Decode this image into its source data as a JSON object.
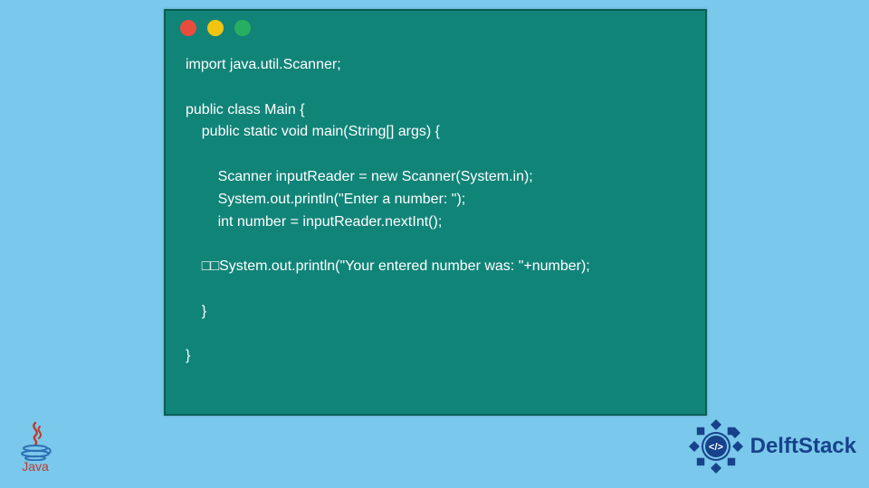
{
  "code": {
    "lines": [
      "import java.util.Scanner;",
      "",
      "public class Main {",
      "    public static void main(String[] args) {",
      "",
      "        Scanner inputReader = new Scanner(System.in);",
      "        System.out.println(\"Enter a number: \");",
      "        int number = inputReader.nextInt();",
      "",
      "    □□System.out.println(\"Your entered number was: \"+number);",
      "",
      "    }",
      "",
      "}"
    ]
  },
  "logos": {
    "java_label": "Java",
    "delft_label": "DelftStack"
  },
  "colors": {
    "bg": "#7ac8eb",
    "window": "#118478",
    "window_border": "#0a5d55",
    "dot_red": "#e74c3c",
    "dot_yellow": "#f1c40f",
    "dot_green": "#27ae60",
    "java_red": "#c0392b",
    "java_blue": "#2d6fb5",
    "delft_blue": "#17428b"
  }
}
